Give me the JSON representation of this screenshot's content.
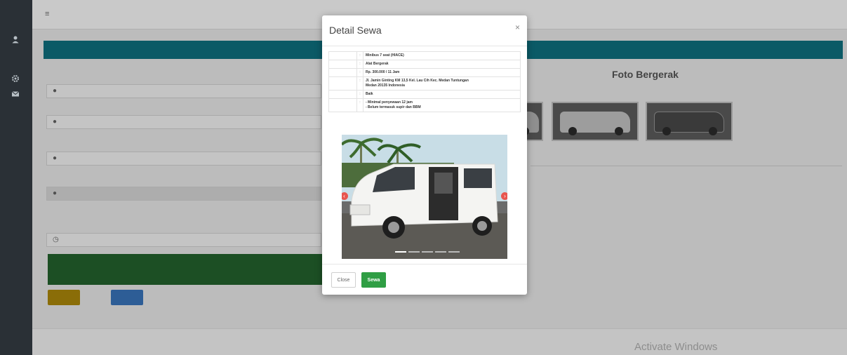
{
  "sidebar": {
    "brand": "",
    "icons": [
      "user-icon",
      "gear-icon",
      "mail-icon"
    ]
  },
  "topbar": {
    "menu_icon": "hamburger-icon",
    "right_text": ""
  },
  "background": {
    "card_header": "",
    "form_labels": [
      "",
      "",
      "",
      "",
      ""
    ],
    "form_placeholders": [
      "",
      "",
      "",
      "",
      ""
    ],
    "help_text": "",
    "notice_text": "",
    "secondary_button": "",
    "foto_title": "Foto Bergerak",
    "footer_left": "",
    "footer_right": ""
  },
  "os_watermark": "Activate Windows",
  "modal": {
    "title": "Detail Sewa",
    "close_symbol": "×",
    "details": [
      {
        "key": "",
        "sep": ":",
        "value": [
          "Minibus 7 seat (HIACE)"
        ]
      },
      {
        "key": "",
        "sep": ":",
        "value": [
          "Alat Bergerak"
        ]
      },
      {
        "key": "",
        "sep": ":",
        "value": [
          "Rp. 300.000 / 11 Jam"
        ]
      },
      {
        "key": "",
        "sep": ":",
        "value": [
          "Jl. Jamin Ginting KM 13,5 Kel. Lau Cih Kec. Medan Tuntungan",
          "Medan 20135 Indonesia"
        ]
      },
      {
        "key": "",
        "sep": ":",
        "value": [
          "Baik"
        ]
      },
      {
        "key": "",
        "sep": ":",
        "value": [
          "- Minimal penyewaan 12 jam",
          "- Belum termasuk supir dan BBM"
        ]
      }
    ],
    "carousel": {
      "slide_count": 5,
      "active_index": 0,
      "prev_symbol": "‹",
      "next_symbol": "›"
    },
    "buttons": {
      "close": "Close",
      "sewa": "Sewa"
    }
  },
  "colors": {
    "sidebar": "#2a3036",
    "card_header": "#0b5a66",
    "notice": "#1c4f24",
    "sewa_button": "#2f9e44",
    "carousel_control": "#e8554e"
  }
}
